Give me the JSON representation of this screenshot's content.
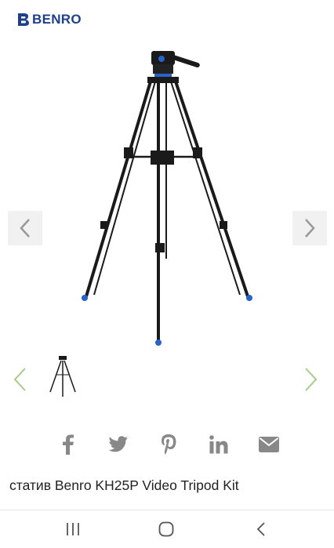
{
  "brand": {
    "name": "BENRO",
    "color": "#1e3f8a"
  },
  "gallery": {
    "image_name": "tripod-image",
    "prev_icon": "chevron-left-icon",
    "next_icon": "chevron-right-icon"
  },
  "thumbnails": {
    "accent_color": "#a8c98a",
    "prev_icon": "chevron-left-icon",
    "next_icon": "chevron-right-icon"
  },
  "share": {
    "icons": [
      "facebook-icon",
      "twitter-icon",
      "pinterest-icon",
      "linkedin-icon",
      "email-icon"
    ],
    "color": "#888888"
  },
  "product": {
    "title": "статив Benro KH25P Video Tripod Kit"
  },
  "system_nav": {
    "icons": [
      "recents-icon",
      "home-icon",
      "back-icon"
    ]
  }
}
